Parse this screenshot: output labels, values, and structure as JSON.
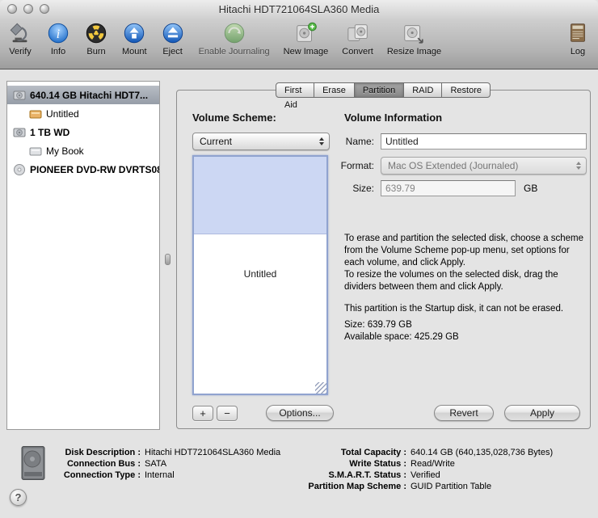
{
  "window": {
    "title": "Hitachi HDT721064SLA360 Media"
  },
  "colors": {
    "partition_highlight": "#ccd7f3",
    "sidebar_selection": "#9aa1ab",
    "chrome_gray": "#b4b4b4"
  },
  "toolbar": {
    "items": [
      {
        "label": "Verify",
        "icon": "microscope-icon"
      },
      {
        "label": "Info",
        "icon": "info-icon"
      },
      {
        "label": "Burn",
        "icon": "burn-icon"
      },
      {
        "label": "Mount",
        "icon": "mount-icon"
      },
      {
        "label": "Eject",
        "icon": "eject-icon"
      },
      {
        "label": "Enable Journaling",
        "icon": "journaling-icon"
      },
      {
        "label": "New Image",
        "icon": "new-image-icon"
      },
      {
        "label": "Convert",
        "icon": "convert-icon"
      },
      {
        "label": "Resize Image",
        "icon": "resize-image-icon"
      },
      {
        "label": "Log",
        "icon": "log-icon"
      }
    ]
  },
  "sidebar": {
    "items": [
      {
        "label": "640.14 GB Hitachi HDT7...",
        "type": "device",
        "selected": true
      },
      {
        "label": "Untitled",
        "type": "volume",
        "selected": false
      },
      {
        "label": "1 TB WD",
        "type": "device",
        "selected": false
      },
      {
        "label": "My Book",
        "type": "volume",
        "selected": false
      },
      {
        "label": "PIONEER DVD-RW DVRTS08",
        "type": "optical-device",
        "selected": false
      }
    ]
  },
  "tabs": {
    "labels": [
      "First Aid",
      "Erase",
      "Partition",
      "RAID",
      "Restore"
    ],
    "selected": "Partition"
  },
  "partition_panel": {
    "volume_scheme_heading": "Volume Scheme:",
    "scheme_value": "Current",
    "partition_name": "Untitled",
    "add_button": "+",
    "remove_button": "−",
    "options_button": "Options...",
    "volume_info_heading": "Volume Information",
    "name_label": "Name:",
    "name_value": "Untitled",
    "format_label": "Format:",
    "format_value": "Mac OS Extended (Journaled)",
    "size_label": "Size:",
    "size_value": "639.79",
    "size_unit": "GB",
    "help_text_1": "To erase and partition the selected disk, choose a scheme from the Volume Scheme pop-up menu, set options for each volume, and click Apply.",
    "help_text_2": "To resize the volumes on the selected disk, drag the dividers between them and click Apply.",
    "startup_note": "This partition is the Startup disk, it can not be erased.",
    "size_note": "Size: 639.79 GB",
    "available_note": "Available space: 425.29 GB",
    "revert_button": "Revert",
    "apply_button": "Apply"
  },
  "info_panel": {
    "rows_left": [
      {
        "label": "Disk Description :",
        "value": "Hitachi HDT721064SLA360 Media"
      },
      {
        "label": "Connection Bus :",
        "value": "SATA"
      },
      {
        "label": "Connection Type :",
        "value": "Internal"
      }
    ],
    "rows_right": [
      {
        "label": "Total Capacity :",
        "value": "640.14 GB (640,135,028,736 Bytes)"
      },
      {
        "label": "Write Status :",
        "value": "Read/Write"
      },
      {
        "label": "S.M.A.R.T. Status :",
        "value": "Verified"
      },
      {
        "label": "Partition Map Scheme :",
        "value": "GUID Partition Table"
      }
    ],
    "help_button": "?"
  }
}
